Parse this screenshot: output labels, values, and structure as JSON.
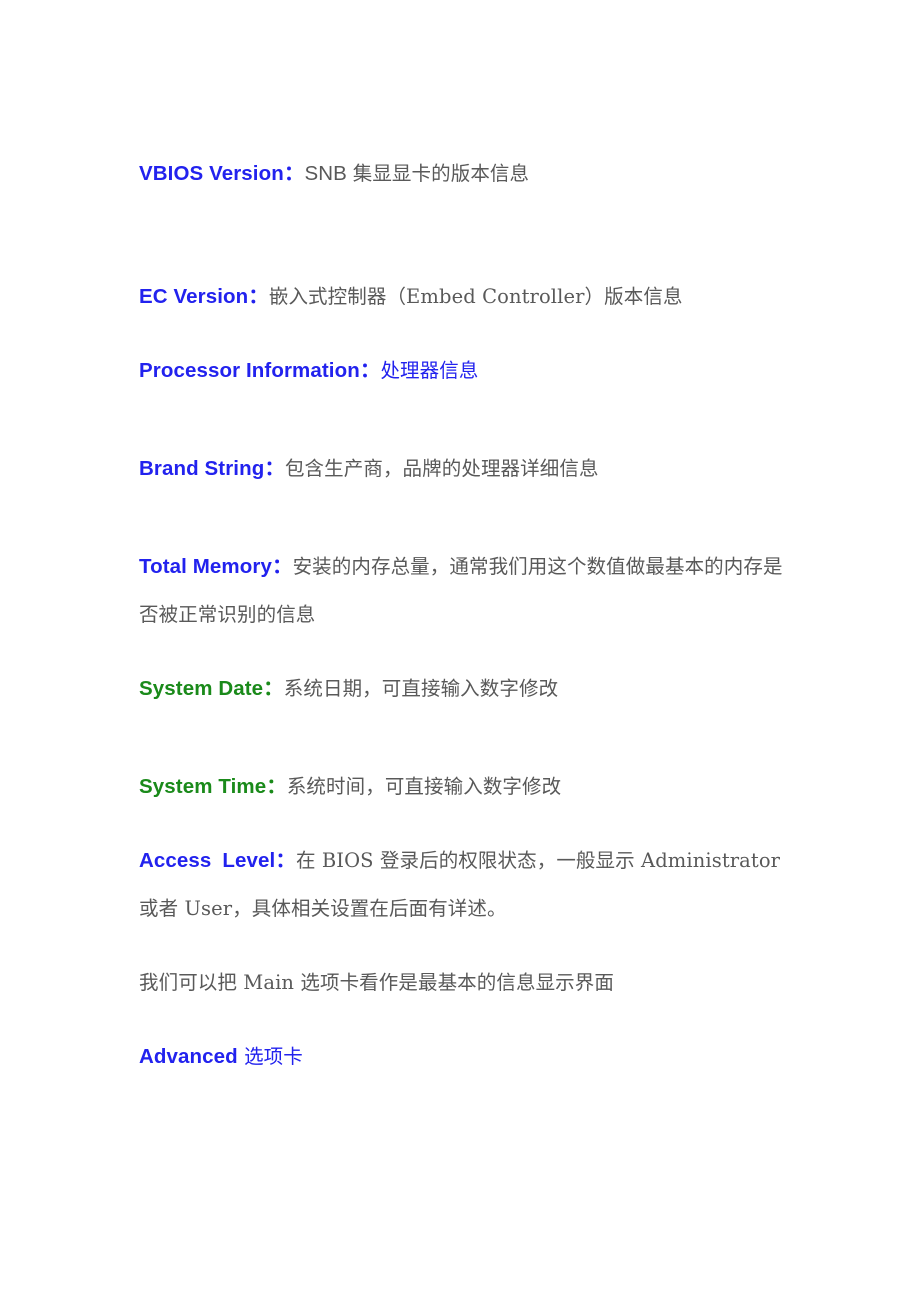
{
  "document": {
    "background_color": "#ffffff",
    "label_blue": "#2222ee",
    "label_green": "#1a8a1a",
    "body_gray": "#595959",
    "colon": "："
  },
  "entries": [
    {
      "id": "vbios-version",
      "label": "VBIOS Version",
      "label_color": "blue",
      "colon": "：",
      "description_prefix": "SNB ",
      "description": "集显显卡的版本信息",
      "description_color": "gray"
    },
    {
      "id": "ec-version",
      "label": "EC Version",
      "label_color": "blue",
      "colon": "：",
      "description_prefix": "",
      "description": "嵌入式控制器（Embed Controller）版本信息",
      "description_color": "gray"
    },
    {
      "id": "processor-information",
      "label": "Processor Information",
      "label_color": "blue",
      "colon": "：",
      "description_prefix": "",
      "description": "处理器信息",
      "description_color": "blue"
    },
    {
      "id": "brand-string",
      "label": "Brand String",
      "label_color": "blue",
      "colon": "：",
      "description_prefix": "",
      "description": "包含生产商，品牌的处理器详细信息",
      "description_color": "gray"
    },
    {
      "id": "total-memory",
      "label": "Total Memory",
      "label_color": "blue",
      "colon": "：",
      "description_prefix": "",
      "description": "安装的内存总量，通常我们用这个数值做最基本的内存是否被正常识别的信息",
      "description_color": "gray"
    },
    {
      "id": "system-date",
      "label": "System Date",
      "label_color": "green",
      "colon": "：",
      "description_prefix": "",
      "description": "系统日期，可直接输入数字修改",
      "description_color": "gray"
    },
    {
      "id": "system-time",
      "label": "System Time",
      "label_color": "green",
      "colon": "：",
      "description_prefix": "",
      "description": "系统时间，可直接输入数字修改",
      "description_color": "gray"
    },
    {
      "id": "access-level",
      "label_part1": "Access",
      "label_part2": "Level",
      "label_color": "blue",
      "colon": "：",
      "description_a": "在 BIOS 登录后的权限状态，一般显示 Administrator 或者 User，具体相关设置在后面有详述。",
      "description_color": "gray"
    }
  ],
  "closing": {
    "main_note": "我们可以把 Main 选项卡看作是最基本的信息显示界面",
    "advanced_label": "Advanced",
    "advanced_suffix": " 选项卡",
    "advanced_color": "blue"
  }
}
